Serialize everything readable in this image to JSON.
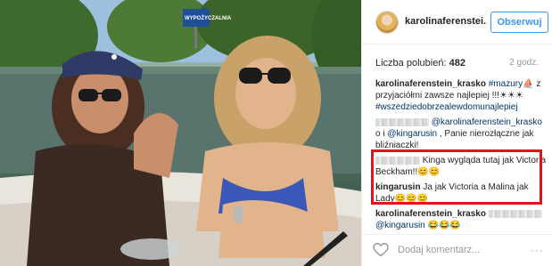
{
  "post": {
    "username": "karolinaferenstei...",
    "follow_label": "Obserwuj",
    "likes_label": "Liczba polubień:",
    "likes_count": "482",
    "time_ago": "2 godz.",
    "add_comment_placeholder": "Dodaj komentarz...",
    "more_label": "···"
  },
  "comments": [
    {
      "user": "karolinaferenstein_krasko",
      "parts": [
        {
          "type": "hashtag",
          "text": "#mazury"
        },
        {
          "type": "text",
          "text": "⛵ z przyjaciółmi zawsze najlepiej !!!☀☀☀ "
        },
        {
          "type": "hashtag",
          "text": "#wszedziedobrzealewdomunajlepiej"
        }
      ]
    },
    {
      "user": "",
      "blur_width": 60,
      "parts": [
        {
          "type": "mention",
          "text": "@karolinaferenstein_krasko"
        },
        {
          "type": "text",
          "text": " o i "
        },
        {
          "type": "mention",
          "text": "@kingarusin"
        },
        {
          "type": "text",
          "text": " , Panie nierozłączne jak bliźniaczki!"
        }
      ]
    },
    {
      "user": "",
      "blur_width": 50,
      "parts": [
        {
          "type": "text",
          "text": " Kinga wygląda tutaj jak Victoria Beckham!!😊😊"
        }
      ]
    },
    {
      "user": "kingarusin",
      "parts": [
        {
          "type": "text",
          "text": " Ja jak Victoria a Malina jak Lady😊😊😊"
        }
      ]
    },
    {
      "user": "karolinaferenstein_krasko",
      "blur_after": 60,
      "parts": [
        {
          "type": "mention",
          "text": "@kingarusin"
        },
        {
          "type": "text",
          "text": " 😂😂😂"
        }
      ]
    }
  ],
  "photo": {
    "sign_text": "WYPOŻYCZALNIA",
    "hat_logo": "polo-logo-icon"
  },
  "colors": {
    "accent": "#3897f0",
    "link": "#003569",
    "highlight": "#e3131e"
  }
}
